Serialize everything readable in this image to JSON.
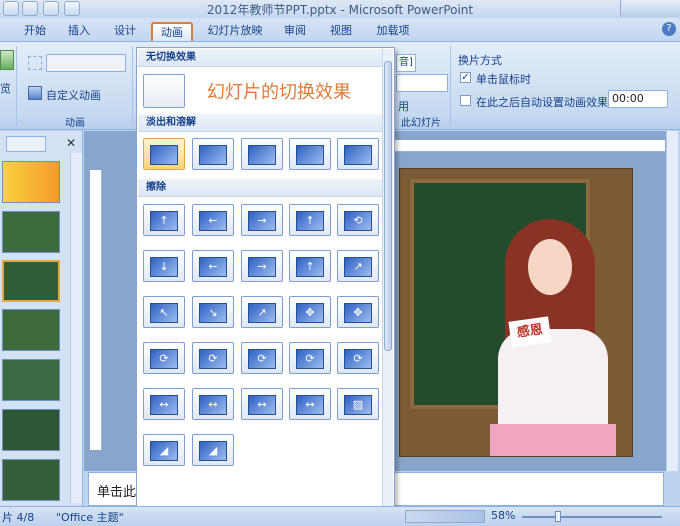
{
  "window": {
    "title": "2012年教师节PPT.pptx - Microsoft PowerPoint"
  },
  "tabs": [
    {
      "label": "开始",
      "active": false
    },
    {
      "label": "插入",
      "active": false
    },
    {
      "label": "设计",
      "active": false
    },
    {
      "label": "动画",
      "active": true
    },
    {
      "label": "幻灯片放映",
      "active": false
    },
    {
      "label": "审阅",
      "active": false
    },
    {
      "label": "视图",
      "active": false
    },
    {
      "label": "加载项",
      "active": false
    }
  ],
  "ribbon": {
    "custom_animation": "自定义动画",
    "preview_label": "览",
    "animation_group": "动画",
    "combo_partial": "音]",
    "apply_partial": "用",
    "slides_partial": "此幻灯片",
    "advance_title": "换片方式",
    "on_click_label": "单击鼠标时",
    "on_click_checked": true,
    "auto_label": "在此之后自动设置动画效果:",
    "auto_checked": false,
    "auto_time": "00:00"
  },
  "gallery": {
    "no_transition_header": "无切换效果",
    "no_transition_label": "幻灯片的切换效果",
    "fade_header": "淡出和溶解",
    "wipe_header": "擦除",
    "fade_count": 5,
    "wipe_rows": 6
  },
  "slide": {
    "card_text": "感恩"
  },
  "notes": {
    "placeholder": "单击此"
  },
  "status": {
    "slide_indicator": "片 4/8",
    "theme": "\"Office 主题\"",
    "zoom": "58%"
  }
}
